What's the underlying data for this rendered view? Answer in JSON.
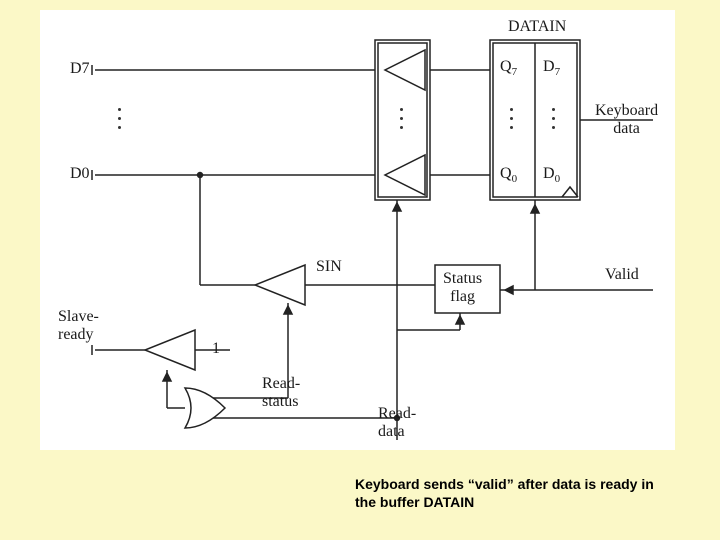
{
  "labels": {
    "d7": "D7",
    "d0": "D0",
    "datain": "DATAIN",
    "q7": "Q",
    "q7sub": "7",
    "d7r": "D",
    "d7rsub": "7",
    "q0": "Q",
    "q0sub": "0",
    "d0r": "D",
    "d0rsub": "0",
    "keyboard_data": "Keyboard\ndata",
    "valid": "Valid",
    "sin": "SIN",
    "status_flag": "Status\nflag",
    "slave_ready": "Slave-\nready",
    "one": "1",
    "read_status": "Read-\nstatus",
    "read_data": "Read-\ndata"
  },
  "caption": "Keyboard sends “valid” after data is ready in the buffer DATAIN"
}
